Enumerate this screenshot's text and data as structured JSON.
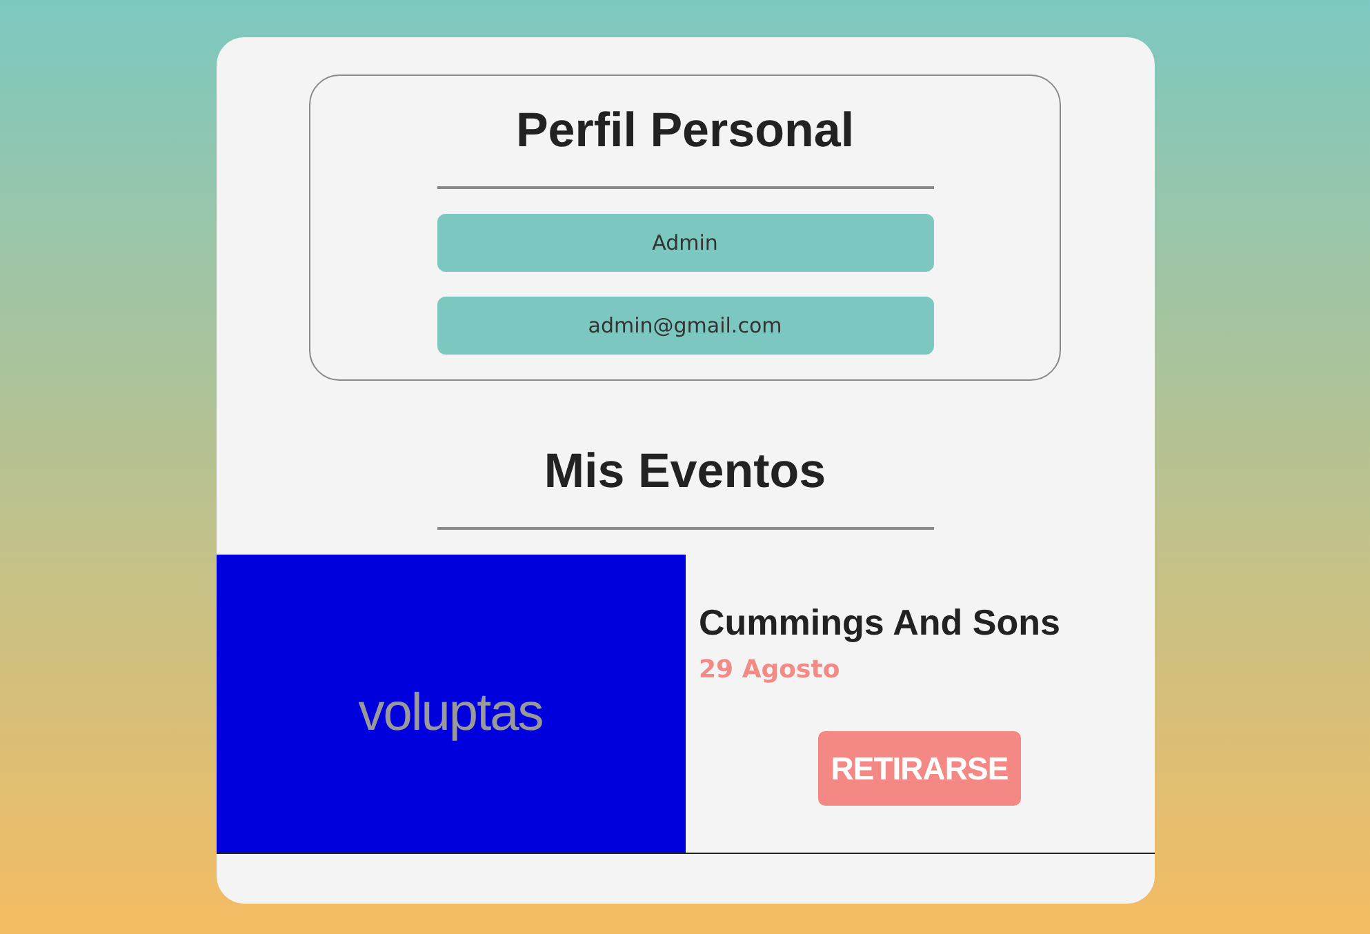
{
  "profile": {
    "title": "Perfil Personal",
    "fields": [
      {
        "value": "Admin"
      },
      {
        "value": "admin@gmail.com"
      }
    ]
  },
  "events_section": {
    "title": "Mis Eventos",
    "events": [
      {
        "image_label": "voluptas",
        "name": "Cummings And Sons",
        "date": "29 Agosto",
        "action": "RETIRARSE"
      }
    ]
  }
}
